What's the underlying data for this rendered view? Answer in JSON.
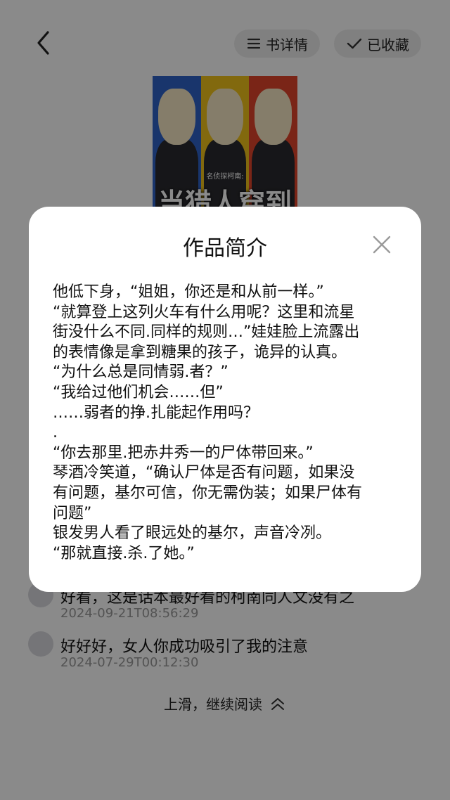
{
  "header": {
    "detail_label": "书详情",
    "favorite_label": "已收藏"
  },
  "cover": {
    "subtitle": "名侦探柯南:",
    "title": "当猎人穿到"
  },
  "modal": {
    "title": "作品简介",
    "lines": [
      "他低下身，“姐姐，你还是和从前一样。”",
      "“就算登上这列火车有什么用呢？这里和流星",
      "街没什么不同.同样的规则…”娃娃脸上流露出",
      "的表情像是拿到糖果的孩子，诡异的认真。",
      "“为什么总是同情弱.者？”",
      "“我给过他们机会……但”",
      "……弱者的挣.扎能起作用吗？",
      ".",
      "“你去那里.把赤井秀一的尸体带回来。”",
      "琴酒冷笑道，“确认尸体是否有问题，如果没",
      "有问题，基尔可信，你无需伪装；如果尸体有",
      "问题”",
      "银发男人看了眼远处的基尔，声音冷冽。",
      "“那就直接.杀.了她。”"
    ]
  },
  "comments": [
    {
      "text": "好看，这是话本最好看的柯南同人文没有之",
      "time": "2024-09-21T08:56:29"
    },
    {
      "text": "好好好，女人你成功吸引了我的注意",
      "time": "2024-07-29T00:12:30"
    }
  ],
  "footer": {
    "continue_label": "上滑，继续阅读"
  },
  "colors": {
    "overlay": "rgba(0,0,0,0.46)",
    "modal_bg": "#ffffff",
    "pill_bg": "#ededed"
  }
}
